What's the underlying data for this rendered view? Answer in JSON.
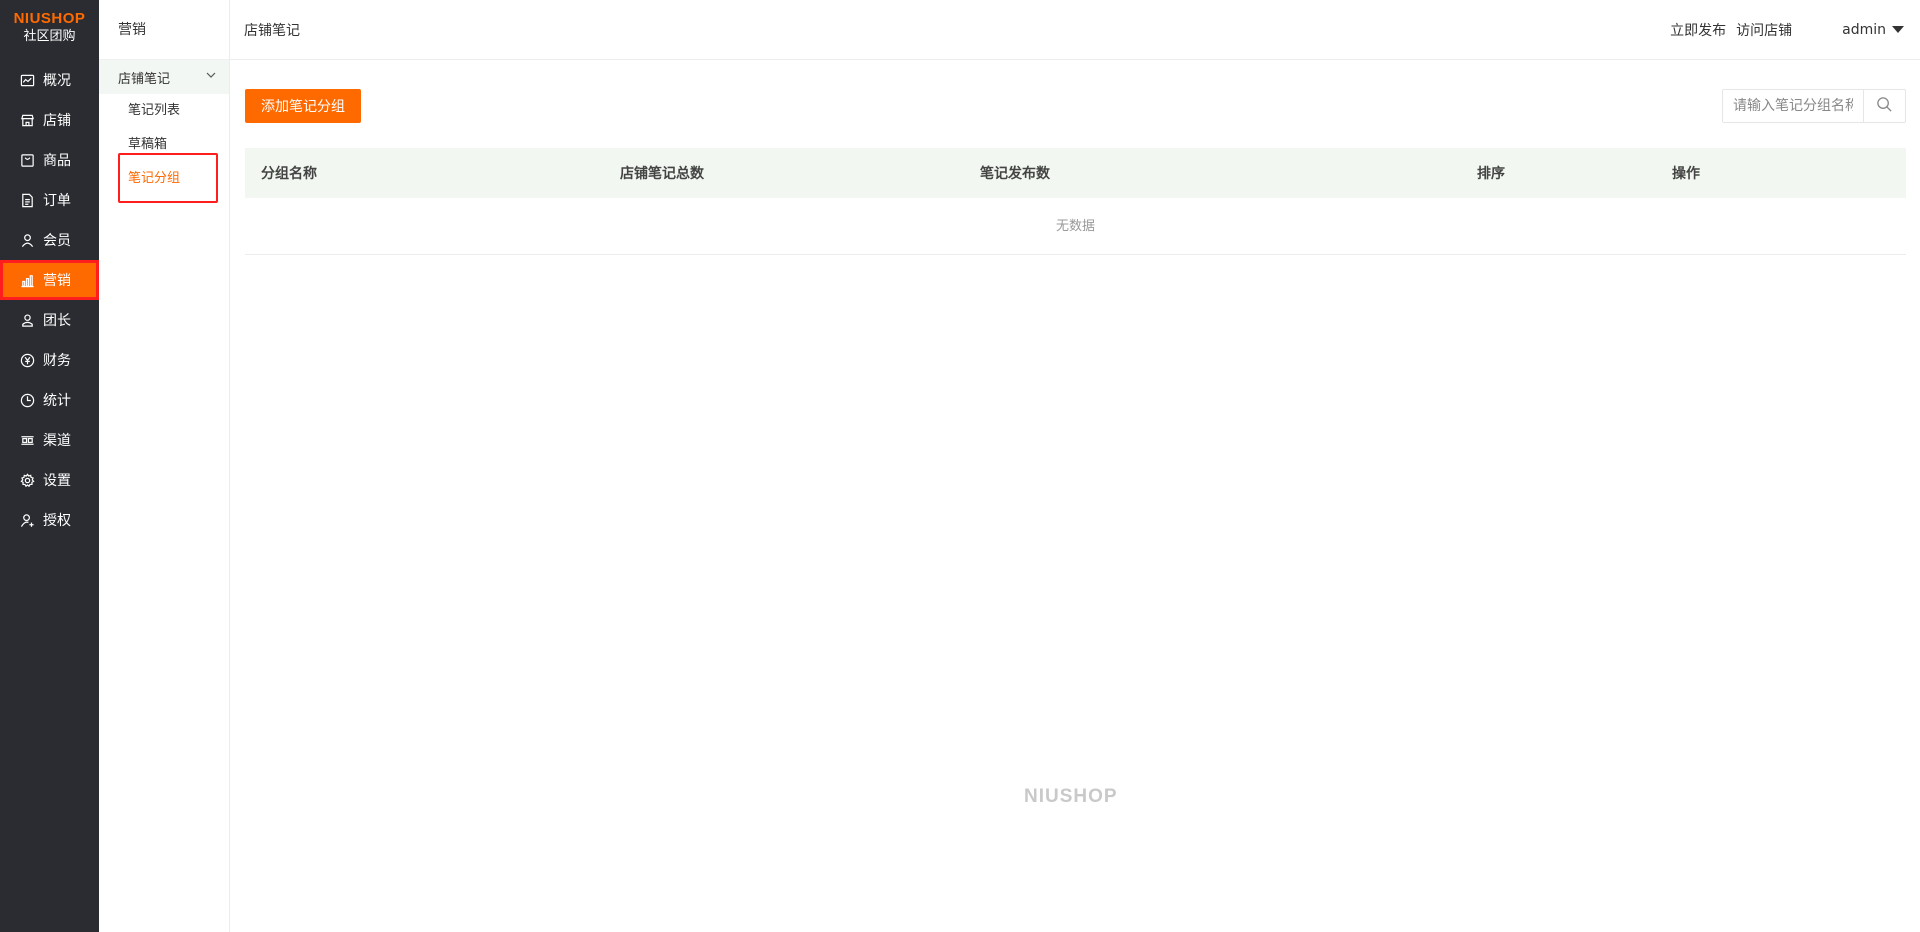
{
  "brand": {
    "logo_text": "NIUSHOP",
    "subtitle": "社区团购",
    "accent": "#ff6a00"
  },
  "sidebar": {
    "items": [
      {
        "label": "概况",
        "icon": "chart-line-icon"
      },
      {
        "label": "店铺",
        "icon": "store-icon"
      },
      {
        "label": "商品",
        "icon": "goods-icon"
      },
      {
        "label": "订单",
        "icon": "order-document-icon"
      },
      {
        "label": "会员",
        "icon": "user-icon"
      },
      {
        "label": "营销",
        "icon": "bar-chart-icon",
        "active": true
      },
      {
        "label": "团长",
        "icon": "leader-user-icon"
      },
      {
        "label": "财务",
        "icon": "yen-icon"
      },
      {
        "label": "统计",
        "icon": "clock-pie-icon"
      },
      {
        "label": "渠道",
        "icon": "channel-icon"
      },
      {
        "label": "设置",
        "icon": "gear-icon"
      },
      {
        "label": "授权",
        "icon": "authorize-user-icon"
      }
    ]
  },
  "subnav": {
    "title": "营销",
    "group_label": "店铺笔记",
    "links": [
      {
        "label": "笔记列表"
      },
      {
        "label": "草稿箱"
      },
      {
        "label": "笔记分组",
        "current": true
      }
    ]
  },
  "header": {
    "breadcrumb": "店铺笔记",
    "publish_label": "立即发布",
    "visit_label": "访问店铺",
    "user_label": "admin"
  },
  "main": {
    "add_button_label": "添加笔记分组",
    "search_placeholder": "请输入笔记分组名称",
    "columns": [
      "分组名称",
      "店铺笔记总数",
      "笔记发布数",
      "排序",
      "操作"
    ],
    "empty_text": "无数据",
    "footer_logo": "NIUSHOP"
  }
}
